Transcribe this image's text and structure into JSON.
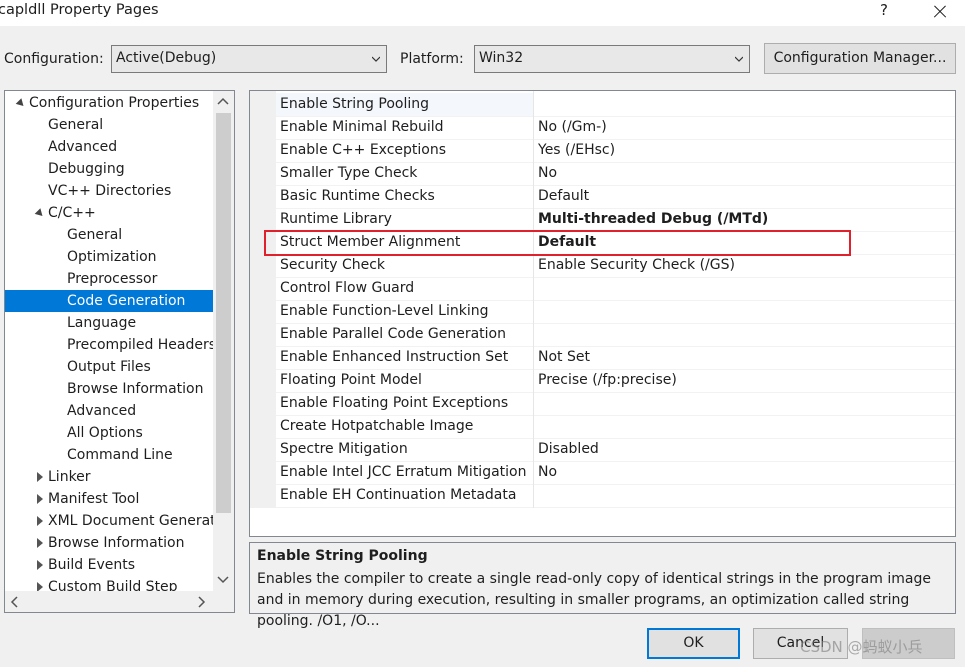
{
  "window": {
    "title": "capldll Property Pages",
    "help_label": "?"
  },
  "config_bar": {
    "configuration_label": "Configuration:",
    "configuration_value": "Active(Debug)",
    "platform_label": "Platform:",
    "platform_value": "Win32",
    "manager_button": "Configuration Manager..."
  },
  "tree": {
    "items": [
      {
        "label": "Configuration Properties",
        "state": "expanded",
        "level": 0
      },
      {
        "label": "General",
        "state": "leaf",
        "level": 1
      },
      {
        "label": "Advanced",
        "state": "leaf",
        "level": 1
      },
      {
        "label": "Debugging",
        "state": "leaf",
        "level": 1
      },
      {
        "label": "VC++ Directories",
        "state": "leaf",
        "level": 1
      },
      {
        "label": "C/C++",
        "state": "expanded",
        "level": 1
      },
      {
        "label": "General",
        "state": "leaf",
        "level": 2
      },
      {
        "label": "Optimization",
        "state": "leaf",
        "level": 2
      },
      {
        "label": "Preprocessor",
        "state": "leaf",
        "level": 2
      },
      {
        "label": "Code Generation",
        "state": "selected",
        "level": 2
      },
      {
        "label": "Language",
        "state": "leaf",
        "level": 2
      },
      {
        "label": "Precompiled Headers",
        "state": "leaf",
        "level": 2
      },
      {
        "label": "Output Files",
        "state": "leaf",
        "level": 2
      },
      {
        "label": "Browse Information",
        "state": "leaf",
        "level": 2
      },
      {
        "label": "Advanced",
        "state": "leaf",
        "level": 2
      },
      {
        "label": "All Options",
        "state": "leaf",
        "level": 2
      },
      {
        "label": "Command Line",
        "state": "leaf",
        "level": 2
      },
      {
        "label": "Linker",
        "state": "collapsed",
        "level": 1
      },
      {
        "label": "Manifest Tool",
        "state": "collapsed",
        "level": 1
      },
      {
        "label": "XML Document Generator",
        "state": "collapsed",
        "level": 1
      },
      {
        "label": "Browse Information",
        "state": "collapsed",
        "level": 1
      },
      {
        "label": "Build Events",
        "state": "collapsed",
        "level": 1
      },
      {
        "label": "Custom Build Step",
        "state": "collapsed",
        "level": 1
      }
    ]
  },
  "grid": {
    "rows": [
      {
        "name": "Enable String Pooling",
        "value": "",
        "bold": false
      },
      {
        "name": "Enable Minimal Rebuild",
        "value": "No (/Gm-)",
        "bold": false
      },
      {
        "name": "Enable C++ Exceptions",
        "value": "Yes (/EHsc)",
        "bold": false
      },
      {
        "name": "Smaller Type Check",
        "value": "No",
        "bold": false
      },
      {
        "name": "Basic Runtime Checks",
        "value": "Default",
        "bold": false
      },
      {
        "name": "Runtime Library",
        "value": "Multi-threaded Debug (/MTd)",
        "bold": true
      },
      {
        "name": "Struct Member Alignment",
        "value": "Default",
        "bold": true
      },
      {
        "name": "Security Check",
        "value": "Enable Security Check (/GS)",
        "bold": false
      },
      {
        "name": "Control Flow Guard",
        "value": "",
        "bold": false
      },
      {
        "name": "Enable Function-Level Linking",
        "value": "",
        "bold": false
      },
      {
        "name": "Enable Parallel Code Generation",
        "value": "",
        "bold": false
      },
      {
        "name": "Enable Enhanced Instruction Set",
        "value": "Not Set",
        "bold": false
      },
      {
        "name": "Floating Point Model",
        "value": "Precise (/fp:precise)",
        "bold": false
      },
      {
        "name": "Enable Floating Point Exceptions",
        "value": "",
        "bold": false
      },
      {
        "name": "Create Hotpatchable Image",
        "value": "",
        "bold": false
      },
      {
        "name": "Spectre Mitigation",
        "value": "Disabled",
        "bold": false
      },
      {
        "name": "Enable Intel JCC Erratum Mitigation",
        "value": "No",
        "bold": false
      },
      {
        "name": "Enable EH Continuation Metadata",
        "value": "",
        "bold": false
      }
    ]
  },
  "description": {
    "title": "Enable String Pooling",
    "body": "Enables the compiler to create a single read-only copy of identical strings in the program image and in memory during execution, resulting in smaller programs, an optimization called string pooling. /O1, /O..."
  },
  "buttons": {
    "ok": "OK",
    "cancel": "Cancel"
  },
  "watermark": "CSDN @蚂蚁小兵",
  "colors": {
    "selection": "#0078d7",
    "highlight_box": "#e0202a"
  }
}
